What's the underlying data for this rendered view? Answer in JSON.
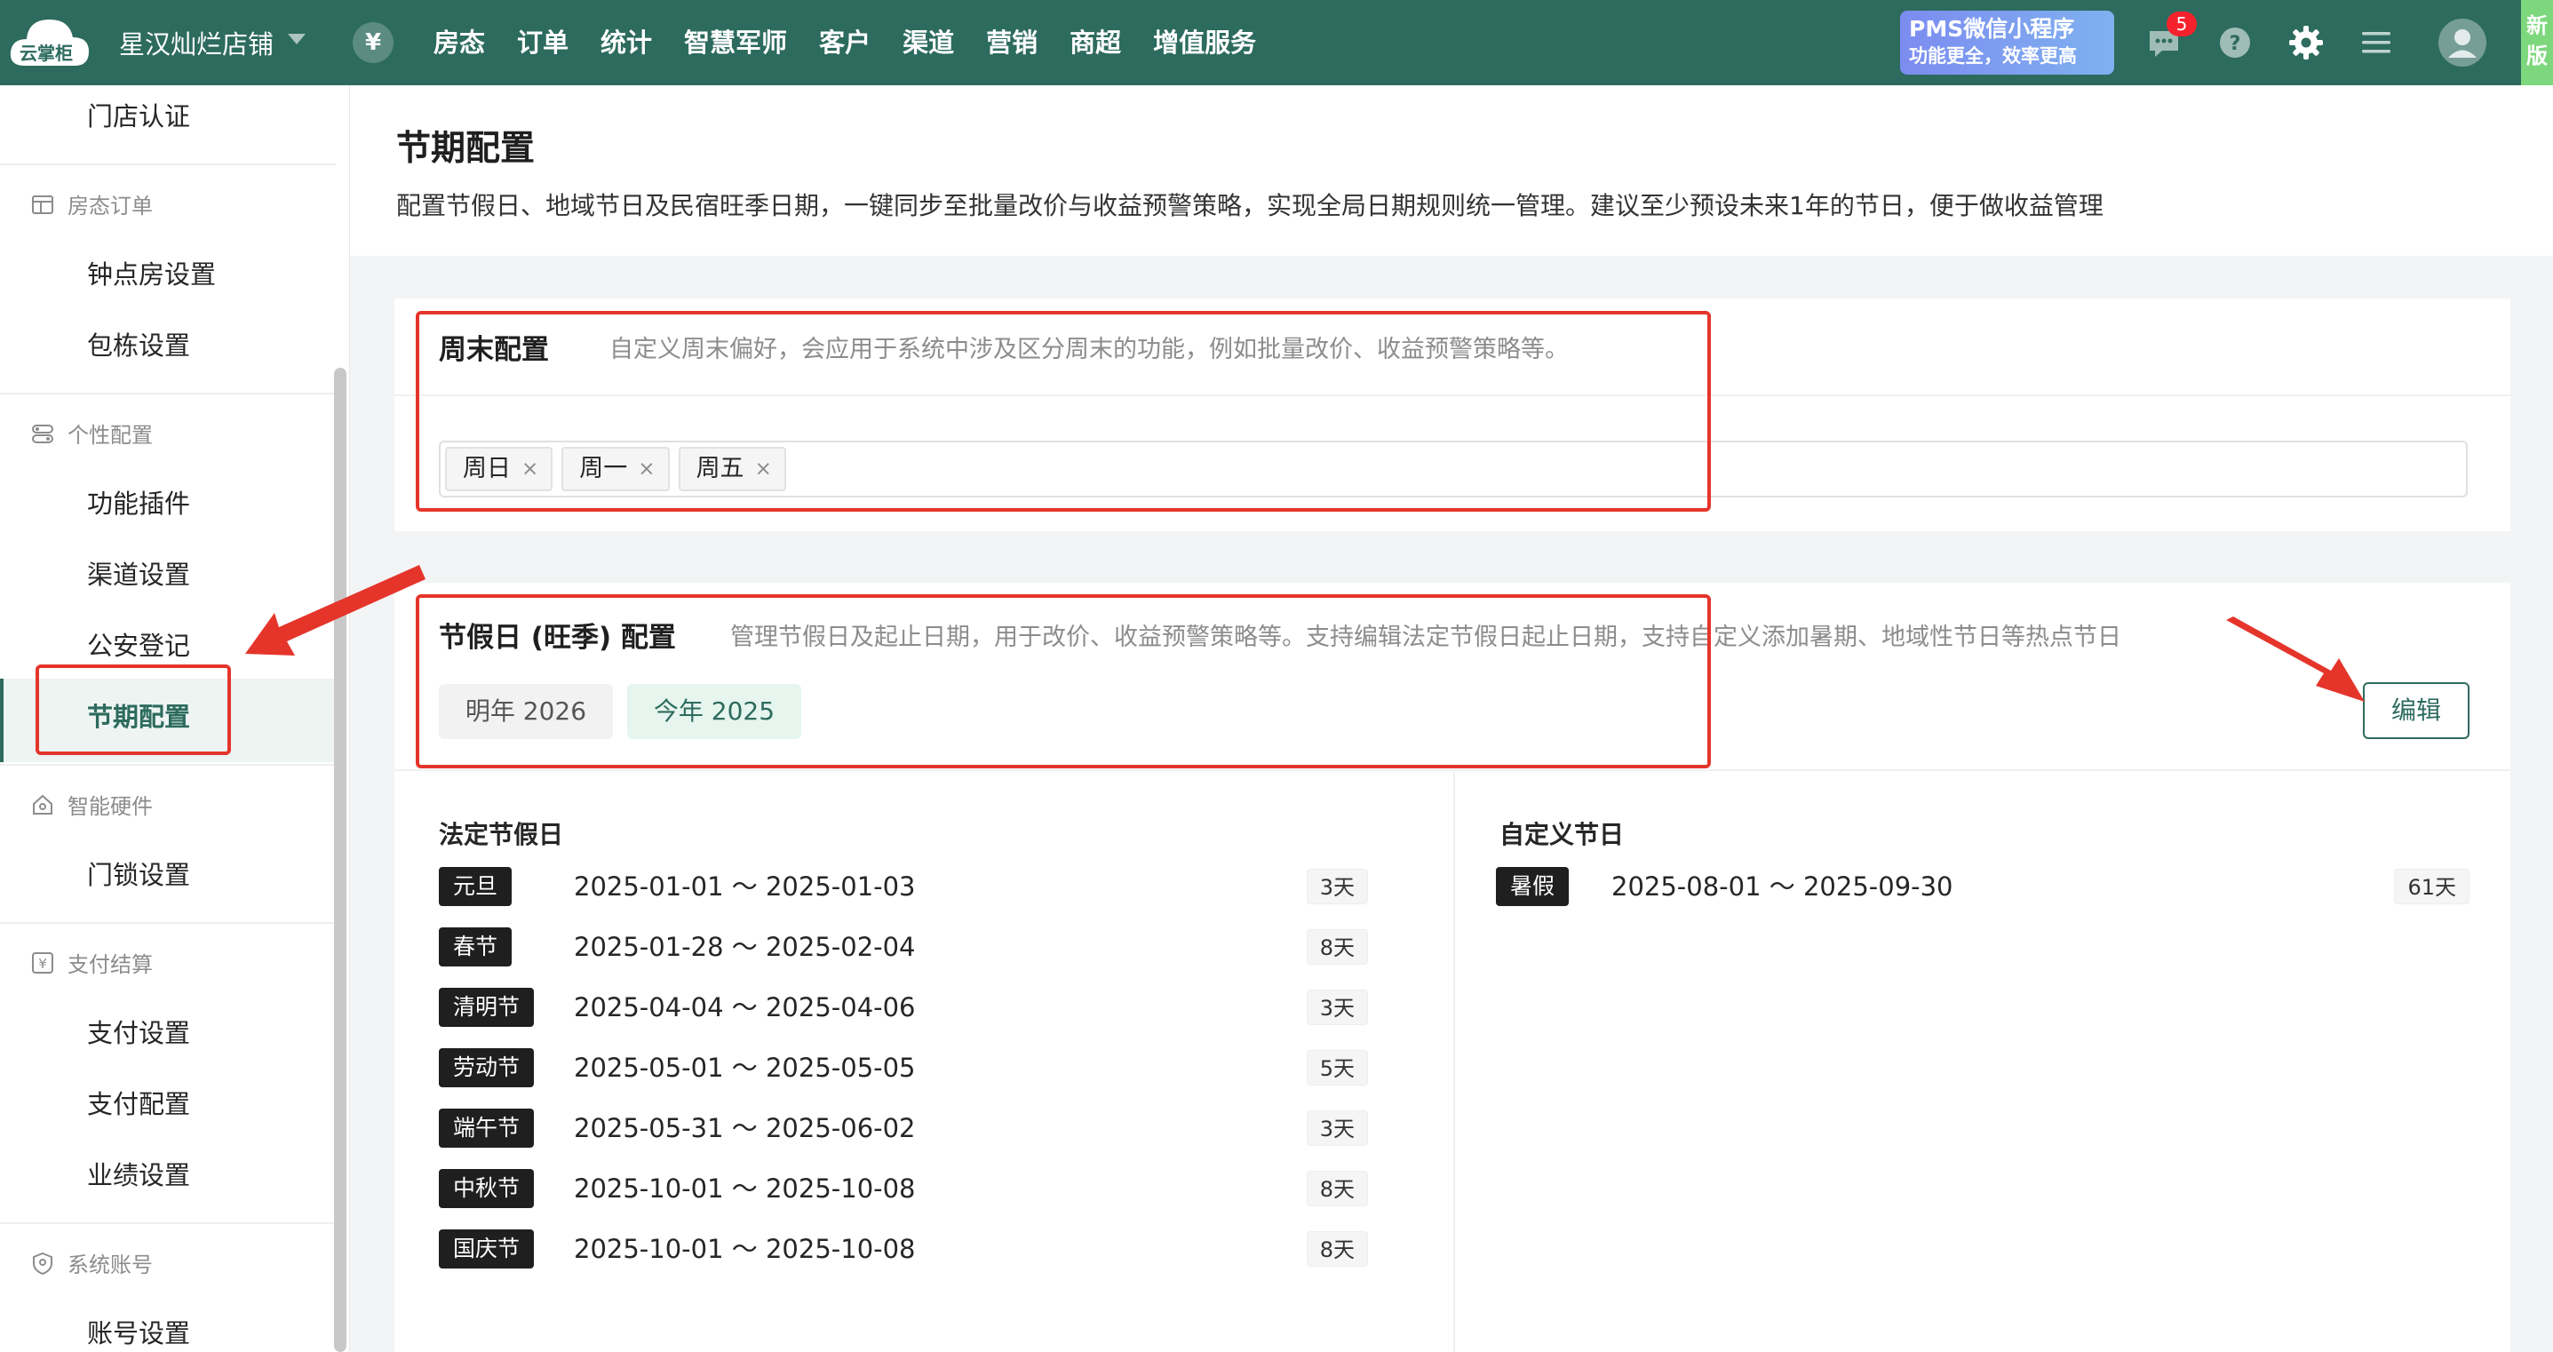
{
  "topbar": {
    "logo_text": "云掌柜",
    "store_name": "星汉灿烂店铺",
    "currency_symbol": "¥",
    "nav": [
      "房态",
      "订单",
      "统计",
      "智慧军师",
      "客户",
      "渠道",
      "营销",
      "商超",
      "增值服务"
    ],
    "promo_title": "PMS微信小程序",
    "promo_sub": "功能更全，效率更高",
    "message_badge": "5",
    "new_version_label": "新版",
    "colors": {
      "bar": "#2d6b5e",
      "promo": "#7c8cf0",
      "badge": "#f5222d"
    },
    "icons": [
      "message-icon",
      "help-icon",
      "gear-icon",
      "menu-icon",
      "avatar-icon"
    ]
  },
  "sidebar": {
    "top_item": "门店认证",
    "groups": [
      {
        "label": "房态订单",
        "icon": "calendar-icon",
        "items": [
          "钟点房设置",
          "包栋设置"
        ]
      },
      {
        "label": "个性配置",
        "icon": "settings-toggle-icon",
        "items": [
          "功能插件",
          "渠道设置",
          "公安登记",
          "节期配置"
        ]
      },
      {
        "label": "智能硬件",
        "icon": "home-device-icon",
        "items": [
          "门锁设置"
        ]
      },
      {
        "label": "支付结算",
        "icon": "yen-icon",
        "items": [
          "支付设置",
          "支付配置",
          "业绩设置"
        ]
      },
      {
        "label": "系统账号",
        "icon": "shield-icon",
        "items": [
          "账号设置"
        ]
      }
    ],
    "active_item": "节期配置"
  },
  "page": {
    "title": "节期配置",
    "description": "配置节假日、地域节日及民宿旺季日期，一键同步至批量改价与收益预警策略，实现全局日期规则统一管理。建议至少预设未来1年的节日，便于做收益管理"
  },
  "weekend": {
    "title": "周末配置",
    "description": "自定义周末偏好，会应用于系统中涉及区分周末的功能，例如批量改价、收益预警策略等。",
    "tags": [
      "周日",
      "周一",
      "周五"
    ],
    "remove_symbol": "×"
  },
  "holiday": {
    "title": "节假日 (旺季) 配置",
    "description": "管理节假日及起止日期，用于改价、收益预警策略等。支持编辑法定节假日起止日期，支持自定义添加暑期、地域性节日等热点节日",
    "year_tabs": [
      "明年 2026",
      "今年 2025"
    ],
    "active_year": "今年 2025",
    "edit_label": "编辑",
    "legal_title": "法定节假日",
    "legal": [
      {
        "name": "元旦",
        "range": "2025-01-01 ～ 2025-01-03",
        "days": "3天"
      },
      {
        "name": "春节",
        "range": "2025-01-28 ～ 2025-02-04",
        "days": "8天"
      },
      {
        "name": "清明节",
        "range": "2025-04-04 ～ 2025-04-06",
        "days": "3天"
      },
      {
        "name": "劳动节",
        "range": "2025-05-01 ～ 2025-05-05",
        "days": "5天"
      },
      {
        "name": "端午节",
        "range": "2025-05-31 ～ 2025-06-02",
        "days": "3天"
      },
      {
        "name": "中秋节",
        "range": "2025-10-01 ～ 2025-10-08",
        "days": "8天"
      },
      {
        "name": "国庆节",
        "range": "2025-10-01 ～ 2025-10-08",
        "days": "8天"
      }
    ],
    "custom_title": "自定义节日",
    "custom": [
      {
        "name": "暑假",
        "range": "2025-08-01 ～ 2025-09-30",
        "days": "61天"
      }
    ]
  },
  "annotation_color": "#e5352b"
}
